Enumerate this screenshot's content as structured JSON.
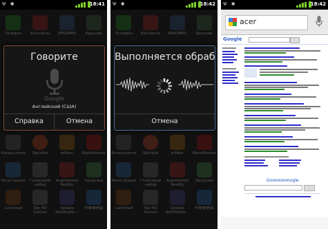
{
  "status_bar": {
    "p1_time": "18:41",
    "p2_time": "18:42",
    "p3_time": "18:42"
  },
  "home_apps": {
    "row1": [
      "Телефон",
      "Контакты",
      "SMS/MMS",
      "Браузер"
    ],
    "row2": [
      "Калькулятор",
      "Sprinkle",
      "arPanc",
      "WaveSecure"
    ],
    "row3": [
      "Регистрация",
      "Голосовой набор",
      "Augmented Reality",
      "Загрузки"
    ],
    "row4": [
      "Lumiread",
      "Top HD Games",
      "Update Notificatio...",
      "中華電信版"
    ]
  },
  "dialog1": {
    "title": "Говорите",
    "logo": "Google",
    "language": "Английский (США)",
    "help_label": "Справка",
    "cancel_label": "Отмена"
  },
  "dialog2": {
    "title": "Выполняется обрабо...",
    "cancel_label": "Отмена"
  },
  "browser": {
    "query": "acer",
    "logo": "Google",
    "pager": "Gooooooooogle"
  },
  "colors": {
    "dialog_border": "#8a4a3a",
    "dialog2_border": "#4c6e9a",
    "link": "#2a2acb",
    "url_green": "#2a8a2a"
  }
}
